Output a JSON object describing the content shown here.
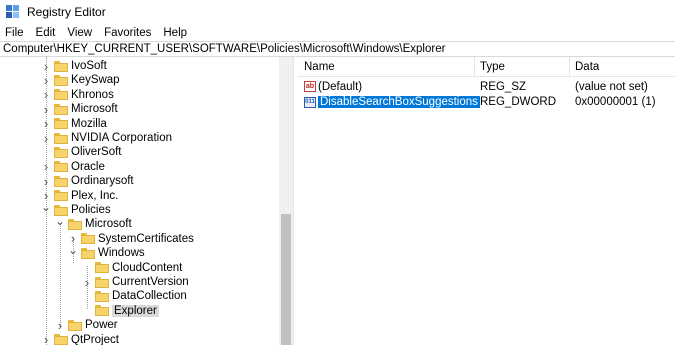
{
  "window": {
    "title": "Registry Editor"
  },
  "menu": [
    "File",
    "Edit",
    "View",
    "Favorites",
    "Help"
  ],
  "address": "Computer\\HKEY_CURRENT_USER\\SOFTWARE\\Policies\\Microsoft\\Windows\\Explorer",
  "tree": [
    {
      "label": "IvoSoft",
      "expander": "chevron-right"
    },
    {
      "label": "KeySwap",
      "expander": "chevron-right"
    },
    {
      "label": "Khronos",
      "expander": "chevron-right"
    },
    {
      "label": "Microsoft",
      "expander": "chevron-right"
    },
    {
      "label": "Mozilla",
      "expander": "chevron-right"
    },
    {
      "label": "NVIDIA Corporation",
      "expander": "chevron-right"
    },
    {
      "label": "OliverSoft",
      "expander": "none"
    },
    {
      "label": "Oracle",
      "expander": "chevron-right"
    },
    {
      "label": "Ordinarysoft",
      "expander": "chevron-right"
    },
    {
      "label": "Plex, Inc.",
      "expander": "chevron-right"
    },
    {
      "label": "Policies",
      "expander": "chevron-down"
    },
    {
      "label": "Microsoft",
      "expander": "chevron-down"
    },
    {
      "label": "SystemCertificates",
      "expander": "chevron-right"
    },
    {
      "label": "Windows",
      "expander": "chevron-down"
    },
    {
      "label": "CloudContent",
      "expander": "none"
    },
    {
      "label": "CurrentVersion",
      "expander": "chevron-right"
    },
    {
      "label": "DataCollection",
      "expander": "none"
    },
    {
      "label": "Explorer",
      "expander": "none",
      "selected": true
    },
    {
      "label": "Power",
      "expander": "chevron-right"
    },
    {
      "label": "QtProject",
      "expander": "chevron-right"
    }
  ],
  "list": {
    "headers": {
      "name": "Name",
      "type": "Type",
      "data": "Data"
    },
    "rows": [
      {
        "name": "(Default)",
        "type": "REG_SZ",
        "data": "(value not set)",
        "icon": "string-value-icon",
        "icon_text": "ab"
      },
      {
        "name": "DisableSearchBoxSuggestions",
        "type": "REG_DWORD",
        "data": "0x00000001 (1)",
        "icon": "dword-value-icon",
        "icon_text": "011",
        "selected": true
      }
    ]
  },
  "colors": {
    "selection": "#0078d7",
    "folder": "#f7d36b"
  }
}
